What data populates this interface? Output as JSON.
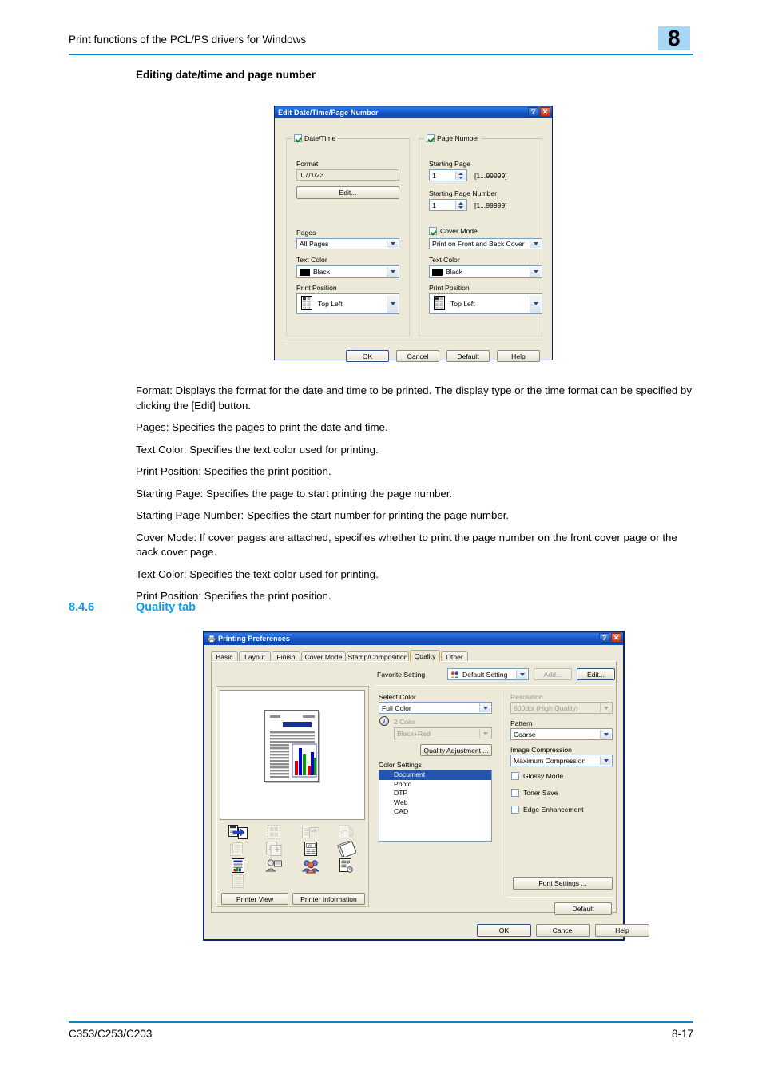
{
  "header": {
    "title": "Print functions of the PCL/PS drivers for Windows",
    "chapter": "8"
  },
  "subheading": "Editing date/time and page number",
  "dialog1": {
    "title": "Edit Date/Time/Page Number",
    "help_btn": "?",
    "close_btn": "✕",
    "left": {
      "group_label": "Date/Time",
      "format_label": "Format",
      "format_value": "'07/1/23",
      "edit_button": "Edit...",
      "pages_label": "Pages",
      "pages_value": "All Pages",
      "text_color_label": "Text Color",
      "text_color_value": "Black",
      "print_position_label": "Print Position",
      "print_position_value": "Top Left"
    },
    "right": {
      "group_label": "Page Number",
      "starting_page_label": "Starting Page",
      "starting_page_value": "1",
      "starting_page_range": "[1...99999]",
      "starting_page_number_label": "Starting Page Number",
      "starting_page_number_value": "1",
      "starting_page_number_range": "[1...99999]",
      "cover_mode_label": "Cover Mode",
      "cover_mode_value": "Print on Front and Back Cover",
      "text_color_label": "Text Color",
      "text_color_value": "Black",
      "print_position_label": "Print Position",
      "print_position_value": "Top Left"
    },
    "buttons": {
      "ok": "OK",
      "cancel": "Cancel",
      "default": "Default",
      "help": "Help"
    }
  },
  "paragraphs": [
    "Format: Displays the format for the date and time to be printed. The display type or the time format can be specified by clicking the [Edit] button.",
    "Pages: Specifies the pages to print the date and time.",
    "Text Color: Specifies the text color used for printing.",
    "Print Position: Specifies the print position.",
    "Starting Page: Specifies the page to start printing the page number.",
    "Starting Page Number: Specifies the start number for printing the page number.",
    "Cover Mode: If cover pages are attached, specifies whether to print the page number on the front cover page or the back cover page.",
    "Text Color: Specifies the text color used for printing.",
    "Print Position: Specifies the print position."
  ],
  "section": {
    "number": "8.4.6",
    "title": "Quality tab"
  },
  "dialog2": {
    "title": "Printing Preferences",
    "help_btn": "?",
    "close_btn": "✕",
    "tabs": [
      {
        "label": "Basic",
        "active": false
      },
      {
        "label": "Layout",
        "active": false
      },
      {
        "label": "Finish",
        "active": false
      },
      {
        "label": "Cover Mode",
        "active": false
      },
      {
        "label": "Stamp/Composition",
        "active": false
      },
      {
        "label": "Quality",
        "active": true
      },
      {
        "label": "Other",
        "active": false
      }
    ],
    "favorite_setting": {
      "label": "Favorite Setting",
      "value": "Default Setting",
      "add_button": "Add...",
      "edit_button": "Edit..."
    },
    "left_panel": {
      "printer_view_button": "Printer View",
      "printer_information_button": "Printer Information"
    },
    "select_color": {
      "label": "Select Color",
      "value": "Full Color",
      "two_color_label": "2 Color",
      "two_color_value": "Black+Red",
      "quality_adjustment_button": "Quality Adjustment ..."
    },
    "color_settings": {
      "label": "Color Settings",
      "items": [
        "Document",
        "Photo",
        "DTP",
        "Web",
        "CAD"
      ],
      "selected": "Document"
    },
    "resolution": {
      "label": "Resolution",
      "value": "600dpi (High Quality)"
    },
    "pattern": {
      "label": "Pattern",
      "value": "Coarse"
    },
    "image_compression": {
      "label": "Image Compression",
      "value": "Maximum Compression"
    },
    "checkboxes": [
      {
        "label": "Glossy Mode",
        "checked": false
      },
      {
        "label": "Toner Save",
        "checked": false
      },
      {
        "label": "Edge Enhancement",
        "checked": false
      }
    ],
    "font_settings_button": "Font Settings ...",
    "default_button": "Default",
    "buttons": {
      "ok": "OK",
      "cancel": "Cancel",
      "help": "Help"
    }
  },
  "footer": {
    "model": "C353/C253/C203",
    "page": "8-17"
  }
}
